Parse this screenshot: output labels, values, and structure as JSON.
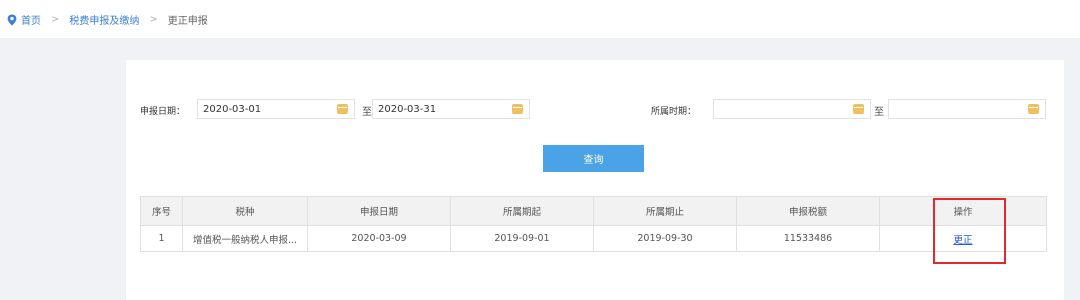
{
  "breadcrumb": {
    "home": "首页",
    "section": "税费申报及缴纳",
    "current": "更正申报"
  },
  "filters": {
    "declare_date_label": "申报日期：",
    "declare_date_from": "2020-03-01",
    "to_label": "至",
    "declare_date_to": "2020-03-31",
    "period_label": "所属时期：",
    "period_from": "",
    "period_to": ""
  },
  "query_button": "查询",
  "table": {
    "headers": [
      "序号",
      "税种",
      "申报日期",
      "所属期起",
      "所属期止",
      "申报税额",
      "操作"
    ],
    "rows": [
      {
        "index": "1",
        "tax_type": "增值税一般纳税人申报...",
        "declare_date": "2020-03-09",
        "period_start": "2019-09-01",
        "period_end": "2019-09-30",
        "amount": "11533486",
        "action": "更正"
      }
    ]
  },
  "colors": {
    "accent": "#4aa3e6",
    "link": "#3a7fd5",
    "highlight": "#e3292f",
    "calendar_icon": "#f0c060"
  }
}
